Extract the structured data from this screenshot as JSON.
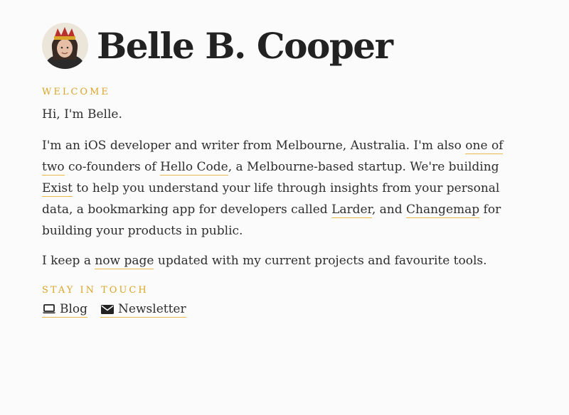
{
  "profile": {
    "name": "Belle B. Cooper"
  },
  "welcome": {
    "heading": "WELCOME",
    "greeting": "Hi, I'm Belle.",
    "bio": {
      "t1": "I'm an iOS developer and writer from Melbourne, Australia. I'm also ",
      "l1": "one of two",
      "t2": " co-founders of ",
      "l2": "Hello Code",
      "t3": ", a Melbourne-based startup. We're building ",
      "l3": "Exist",
      "t4": " to help you understand your life through insights from your personal data, a bookmarking app for developers called ",
      "l4": "Larder",
      "t5": ", and ",
      "l5": "Changemap",
      "t6": " for building your products in public."
    },
    "now": {
      "t1": "I keep a ",
      "l1": "now page",
      "t2": " updated with my current projects and favourite tools."
    }
  },
  "contact": {
    "heading": "STAY IN TOUCH",
    "links": [
      {
        "label": "Blog",
        "icon": "laptop-icon"
      },
      {
        "label": "Newsletter",
        "icon": "envelope-icon"
      }
    ]
  },
  "colors": {
    "accent": "#d9a52a",
    "underline": "#e8b84a",
    "text": "#2e2e2e",
    "background": "#fbfbfb"
  }
}
